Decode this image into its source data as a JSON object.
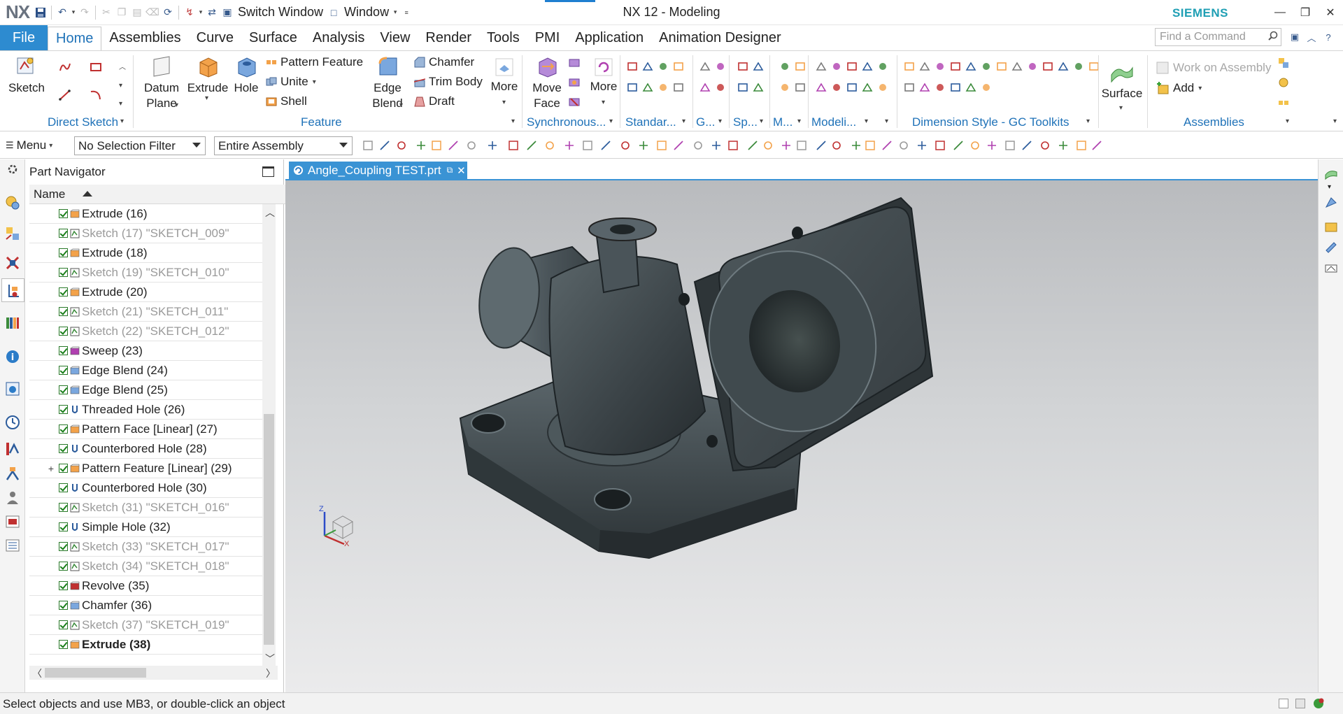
{
  "app": {
    "logo": "NX",
    "title": "NX 12 - Modeling",
    "brand": "SIEMENS",
    "switch_window": "Switch Window",
    "window_menu": "Window"
  },
  "tabs": {
    "file": "File",
    "items": [
      "Home",
      "Assemblies",
      "Curve",
      "Surface",
      "Analysis",
      "View",
      "Render",
      "Tools",
      "PMI",
      "Application",
      "Animation Designer"
    ],
    "active": "Home"
  },
  "search": {
    "placeholder": "Find a Command"
  },
  "ribbon": {
    "direct_sketch": {
      "label": "Direct Sketch",
      "sketch": "Sketch"
    },
    "feature": {
      "label": "Feature",
      "datum_plane_1": "Datum",
      "datum_plane_2": "Plane",
      "extrude": "Extrude",
      "hole": "Hole",
      "pattern_feature": "Pattern Feature",
      "unite": "Unite",
      "shell": "Shell",
      "edge_blend_1": "Edge",
      "edge_blend_2": "Blend",
      "chamfer": "Chamfer",
      "trim_body": "Trim Body",
      "draft": "Draft",
      "more": "More"
    },
    "synchronous": {
      "label": "Synchronous...",
      "move_face_1": "Move",
      "move_face_2": "Face",
      "more": "More"
    },
    "standard": {
      "label": "Standar..."
    },
    "g": {
      "label": "G..."
    },
    "sp": {
      "label": "Sp..."
    },
    "m": {
      "label": "M..."
    },
    "modeling": {
      "label": "Modeli..."
    },
    "dimension_style": {
      "label": "Dimension Style - GC Toolkits"
    },
    "surface": {
      "label": "Surface"
    },
    "assemblies": {
      "label": "Assemblies",
      "work_on_assembly": "Work on Assembly",
      "add": "Add"
    }
  },
  "selection_bar": {
    "menu": "Menu",
    "filter": "No Selection Filter",
    "scope": "Entire Assembly"
  },
  "navigator": {
    "title": "Part Navigator",
    "column": "Name",
    "rows": [
      {
        "label": "Extrude (16)",
        "icon": "extrude",
        "dim": false
      },
      {
        "label": "Sketch (17) \"SKETCH_009\"",
        "icon": "sketch",
        "dim": true
      },
      {
        "label": "Extrude (18)",
        "icon": "extrude",
        "dim": false
      },
      {
        "label": "Sketch (19) \"SKETCH_010\"",
        "icon": "sketch",
        "dim": true
      },
      {
        "label": "Extrude (20)",
        "icon": "extrude",
        "dim": false
      },
      {
        "label": "Sketch (21) \"SKETCH_011\"",
        "icon": "sketch",
        "dim": true
      },
      {
        "label": "Sketch (22) \"SKETCH_012\"",
        "icon": "sketch",
        "dim": true
      },
      {
        "label": "Sweep (23)",
        "icon": "sweep",
        "dim": false
      },
      {
        "label": "Edge Blend (24)",
        "icon": "blend",
        "dim": false
      },
      {
        "label": "Edge Blend (25)",
        "icon": "blend",
        "dim": false
      },
      {
        "label": "Threaded Hole (26)",
        "icon": "hole",
        "dim": false
      },
      {
        "label": "Pattern Face [Linear] (27)",
        "icon": "pattern",
        "dim": false
      },
      {
        "label": "Counterbored Hole (28)",
        "icon": "hole",
        "dim": false
      },
      {
        "label": "Pattern Feature [Linear] (29)",
        "icon": "pattern",
        "dim": false,
        "expandable": true
      },
      {
        "label": "Counterbored Hole (30)",
        "icon": "hole",
        "dim": false
      },
      {
        "label": "Sketch (31) \"SKETCH_016\"",
        "icon": "sketch",
        "dim": true
      },
      {
        "label": "Simple Hole (32)",
        "icon": "hole",
        "dim": false
      },
      {
        "label": "Sketch (33) \"SKETCH_017\"",
        "icon": "sketch",
        "dim": true
      },
      {
        "label": "Sketch (34) \"SKETCH_018\"",
        "icon": "sketch",
        "dim": true
      },
      {
        "label": "Revolve (35)",
        "icon": "revolve",
        "dim": false
      },
      {
        "label": "Chamfer (36)",
        "icon": "chamfer",
        "dim": false
      },
      {
        "label": "Sketch (37) \"SKETCH_019\"",
        "icon": "sketch",
        "dim": true
      },
      {
        "label": "Extrude (38)",
        "icon": "extrude",
        "dim": false,
        "bold": true
      }
    ]
  },
  "document": {
    "tab": "Angle_Coupling TEST.prt"
  },
  "triad": {
    "z": "Z",
    "x": "X"
  },
  "status": {
    "text": "Select objects and use MB3, or double-click an object"
  },
  "colors": {
    "accent": "#2d8bd0",
    "brand": "#1f9fb4",
    "tab_blue": "#3a93d4",
    "model": "#3c4448"
  }
}
